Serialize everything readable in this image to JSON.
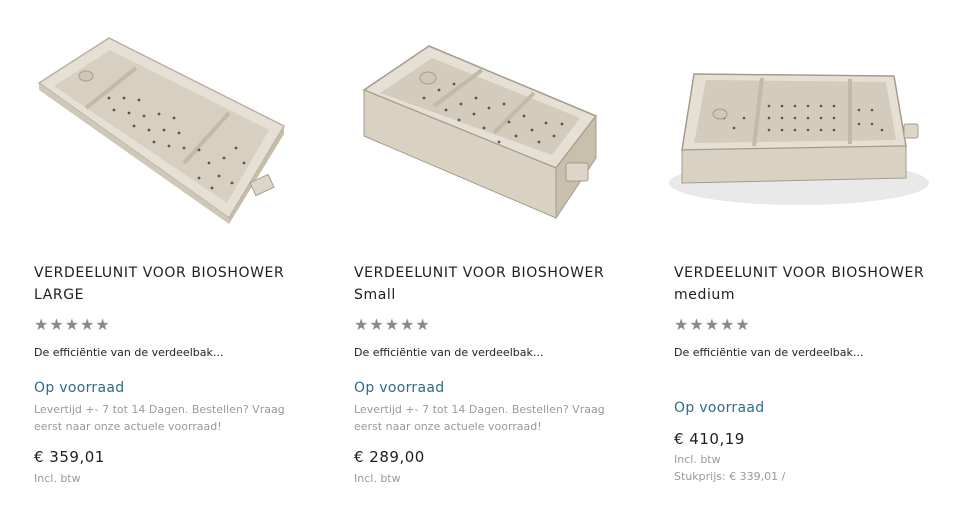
{
  "products": [
    {
      "title_line1": "VERDEELUNIT VOOR BIOSHOWER",
      "title_line2": "LARGE",
      "rating_stars": 5,
      "rating_value": 0,
      "description": "De efficiëntie van de verdeelbak...",
      "stock": "Op voorraad",
      "delivery_line1": "Levertijd +- 7 tot 14 Dagen. Bestellen? Vraag",
      "delivery_line2": "eerst naar onze actuele voorraad!",
      "price": "€ 359,01",
      "vat": "Incl. btw",
      "image": "box-large-photo"
    },
    {
      "title_line1": "VERDEELUNIT VOOR BIOSHOWER",
      "title_line2": "Small",
      "rating_stars": 5,
      "rating_value": 0,
      "description": "De efficiëntie van de verdeelbak...",
      "stock": "Op voorraad",
      "delivery_line1": "Levertijd +- 7 tot 14 Dagen. Bestellen? Vraag",
      "delivery_line2": "eerst naar onze actuele voorraad!",
      "price": "€ 289,00",
      "vat": "Incl. btw",
      "image": "box-small-photo"
    },
    {
      "title_line1": "VERDEELUNIT VOOR BIOSHOWER",
      "title_line2": "medium",
      "rating_stars": 5,
      "rating_value": 0,
      "description": "De efficiëntie van de verdeelbak...",
      "stock": "Op voorraad",
      "price": "€ 410,19",
      "vat": "Incl. btw",
      "unit_price": "Stukprijs: € 339,01 /",
      "image": "box-medium-photo"
    }
  ],
  "colors": {
    "stock_text": "#2c6e8f",
    "star_empty": "#8a8a8a",
    "muted_text": "#9a9a9a",
    "box_plastic": "#ddd6c8"
  },
  "icons": {
    "star": "star-icon"
  }
}
